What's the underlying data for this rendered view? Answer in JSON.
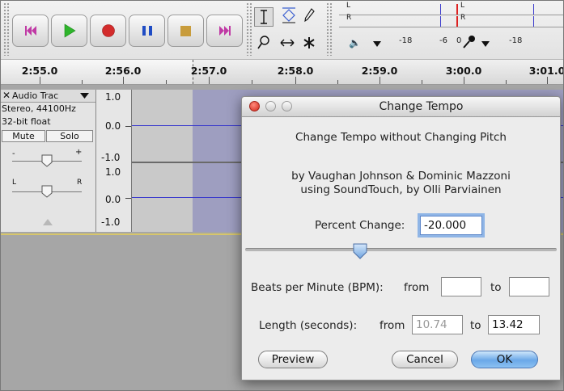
{
  "toolbar": {
    "transport": [
      {
        "name": "skip-start",
        "color": "#c03aa5"
      },
      {
        "name": "play",
        "color": "#2fb52c"
      },
      {
        "name": "record",
        "color": "#d32c2c"
      },
      {
        "name": "pause",
        "color": "#1f4cc4"
      },
      {
        "name": "stop",
        "color": "#c89c3c"
      },
      {
        "name": "skip-end",
        "color": "#c03aa5"
      }
    ],
    "meters": {
      "left_label": "L",
      "right_label": "R",
      "ticks": [
        "-18",
        "-6",
        "0",
        "-18"
      ]
    }
  },
  "ruler": {
    "labels": [
      "2:55.0",
      "2:56.0",
      "2:57.0",
      "2:58.0",
      "2:59.0",
      "3:00.0",
      "3:01.0"
    ]
  },
  "track": {
    "name": "Audio Trac",
    "format_line1": "Stereo, 44100Hz",
    "format_line2": "32-bit float",
    "mute_label": "Mute",
    "solo_label": "Solo",
    "scale_top": [
      "1.0",
      "0.0",
      "-1.0"
    ],
    "scale_bottom": [
      "1.0",
      "0.0",
      "-1.0"
    ],
    "gain_minus": "-",
    "gain_plus": "+",
    "pan_left": "L",
    "pan_right": "R"
  },
  "dialog": {
    "title": "Change Tempo",
    "heading": "Change Tempo without Changing Pitch",
    "credits_line1": "by Vaughan Johnson & Dominic Mazzoni",
    "credits_line2": "using SoundTouch, by Olli Parviainen",
    "percent_label": "Percent Change:",
    "percent_value": "-20.000",
    "slider_fraction": 0.37,
    "bpm_label": "Beats per Minute (BPM):",
    "bpm_from_label": "from",
    "bpm_from_value": "",
    "bpm_to_label": "to",
    "bpm_to_value": "",
    "length_label": "Length (seconds):",
    "length_from_label": "from",
    "length_from_value": "10.74",
    "length_to_label": "to",
    "length_to_value": "13.42",
    "preview_label": "Preview",
    "cancel_label": "Cancel",
    "ok_label": "OK"
  }
}
